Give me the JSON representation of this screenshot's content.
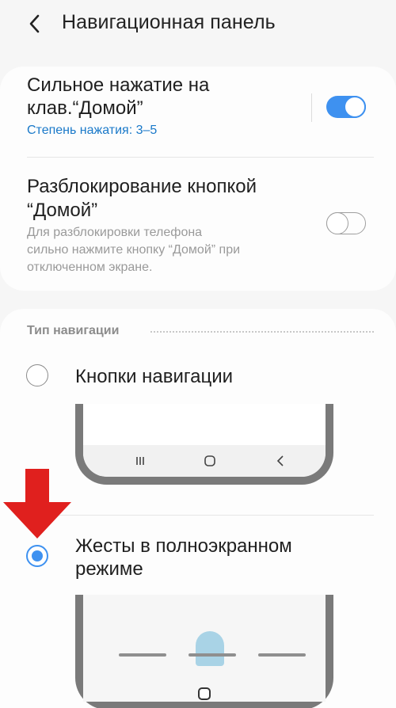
{
  "header": {
    "title": "Навигационная панель",
    "back_icon": "chevron-left-icon"
  },
  "settings": [
    {
      "title_line1": "Сильное нажатие на",
      "title_line2": "клав.“Домой”",
      "subtitle": "Степень нажатия: 3–5",
      "toggle_on": true
    },
    {
      "title_line1": "Разблокирование кнопкой",
      "title_line2": "“Домой”",
      "desc_line1": "Для разблокировки телефона",
      "desc_line2": "сильно нажмите кнопку “Домой” при",
      "desc_line3": "отключенном экране.",
      "toggle_on": false
    }
  ],
  "navigation_type": {
    "label": "Тип навигации",
    "options": [
      {
        "label": "Кнопки навигации",
        "selected": false
      },
      {
        "label_line1": "Жесты в полноэкранном",
        "label_line2": "режиме",
        "selected": true
      }
    ]
  },
  "colors": {
    "accent": "#3e91f0",
    "subtitle_blue": "#1a79c9",
    "arrow_red": "#e0201e"
  }
}
